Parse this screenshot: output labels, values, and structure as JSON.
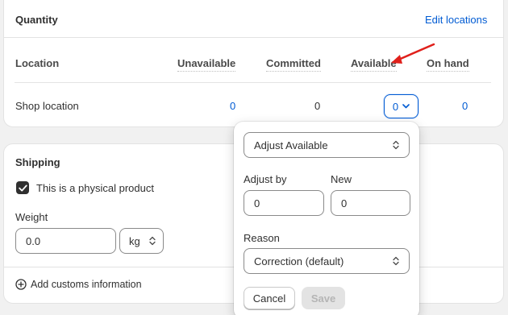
{
  "quantity": {
    "title": "Quantity",
    "edit_link": "Edit locations",
    "columns": [
      "Location",
      "Unavailable",
      "Committed",
      "Available",
      "On hand"
    ],
    "row": {
      "location": "Shop location",
      "unavailable": "0",
      "committed": "0",
      "available": "0",
      "on_hand": "0"
    }
  },
  "shipping": {
    "title": "Shipping",
    "physical_label": "This is a physical product",
    "physical_checked": true,
    "weight_label": "Weight",
    "weight_value": "0.0",
    "weight_unit": "kg",
    "customs_label": "Add customs information"
  },
  "popover": {
    "mode_select": "Adjust Available",
    "adjust_by_label": "Adjust by",
    "adjust_by_value": "0",
    "new_label": "New",
    "new_value": "0",
    "reason_label": "Reason",
    "reason_select": "Correction (default)",
    "cancel_label": "Cancel",
    "save_label": "Save"
  },
  "colors": {
    "link": "#005bd3",
    "annotation_arrow": "#e0201b",
    "checkbox": "#303030"
  }
}
